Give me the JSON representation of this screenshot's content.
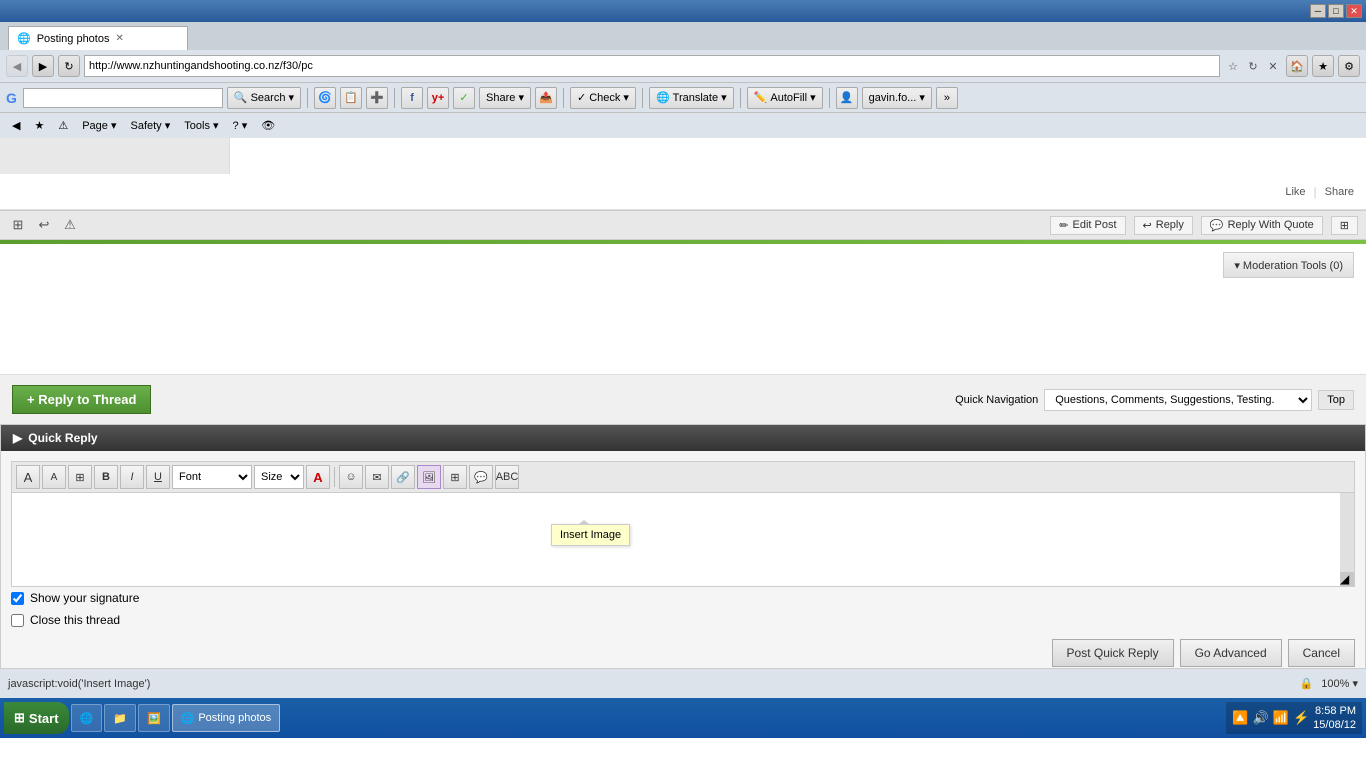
{
  "titlebar": {
    "minimize": "─",
    "maximize": "□",
    "close": "✕"
  },
  "browser": {
    "tab_title": "Posting photos",
    "url": "http://www.nzhuntingandshooting.co.nz/f30/pc",
    "favicon": "🌐"
  },
  "google_toolbar": {
    "search_placeholder": "",
    "search_btn": "Search ▾",
    "check_btn": "Check ▾",
    "translate_btn": "Translate ▾",
    "autofill_btn": "AutoFill ▾",
    "share_btn": "Share ▾",
    "user": "gavin.fo... ▾"
  },
  "ie_toolbar": {
    "page_btn": "Page ▾",
    "safety_btn": "Safety ▾",
    "tools_btn": "Tools ▾",
    "help_btn": "? ▾"
  },
  "post": {
    "like_label": "Like",
    "share_label": "Share",
    "edit_post_label": "Edit Post",
    "reply_label": "Reply",
    "reply_with_quote_label": "Reply With Quote",
    "mod_tools_label": "▾ Moderation Tools (0)"
  },
  "reply_thread": {
    "btn_label": "+ Reply to Thread",
    "quick_nav_label": "Quick Navigation",
    "nav_dropdown": "Questions, Comments, Suggestions, Testing.",
    "top_btn": "Top"
  },
  "quick_reply": {
    "header": "Quick Reply",
    "font_label": "Font",
    "size_label": "Size",
    "editor_placeholder": "",
    "show_signature_label": "Show your signature",
    "close_thread_label": "Close this thread",
    "post_btn": "Post Quick Reply",
    "advanced_btn": "Go Advanced",
    "cancel_btn": "Cancel"
  },
  "tooltip": {
    "insert_image": "Insert Image"
  },
  "status_bar": {
    "url": "javascript:void('Insert Image')"
  },
  "taskbar": {
    "start_label": "Start",
    "items": [
      "🪟",
      "🌐",
      "📁",
      "🖼️"
    ],
    "time": "8:58 PM",
    "date": "15/08/12"
  }
}
